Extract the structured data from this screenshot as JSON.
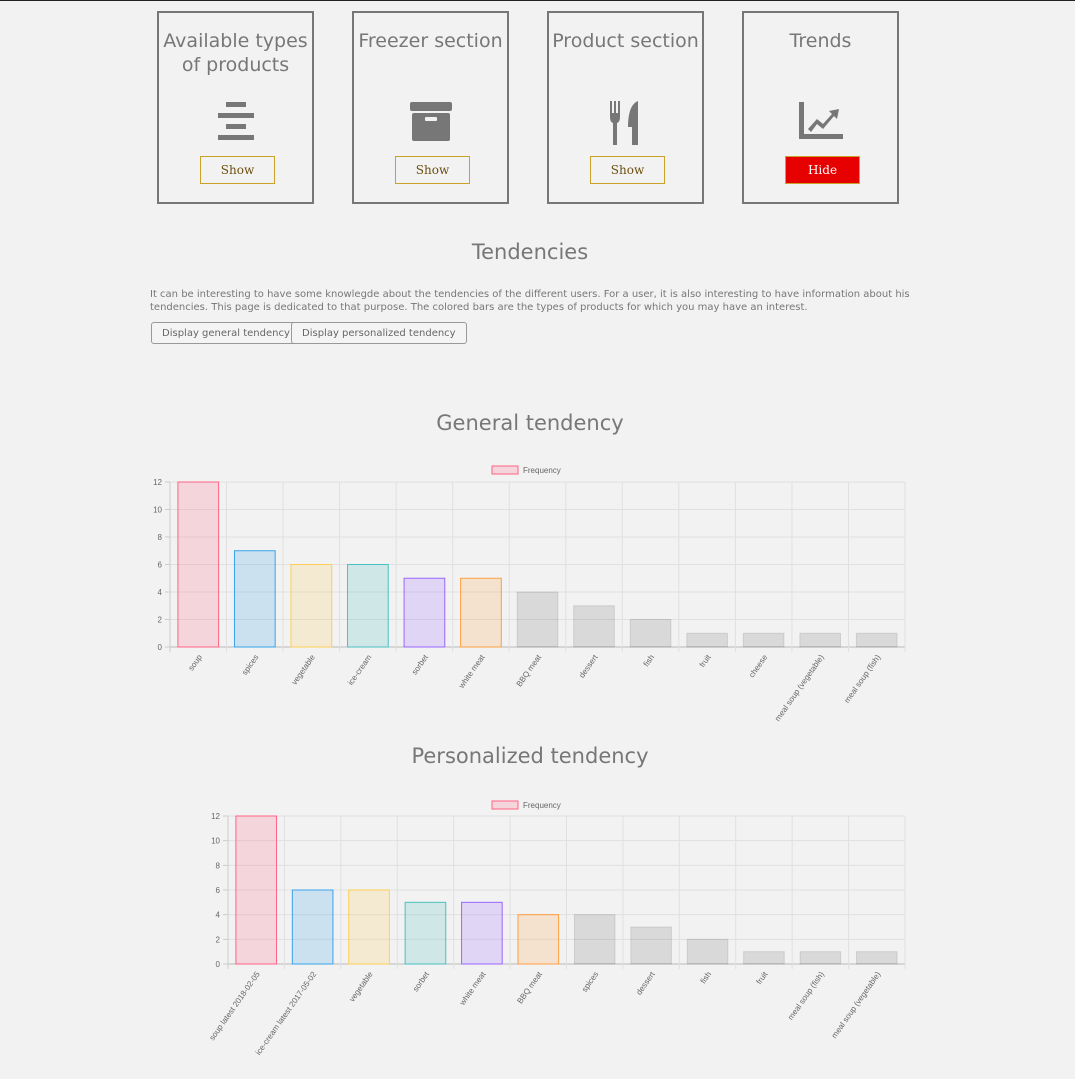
{
  "cards": [
    {
      "title": "Available types of products",
      "icon": "list-align-center-icon",
      "button": "Show"
    },
    {
      "title": "Freezer section",
      "icon": "archive-box-icon",
      "button": "Show"
    },
    {
      "title": "Product section",
      "icon": "fork-knife-icon",
      "button": "Show"
    },
    {
      "title": "Trends",
      "icon": "chart-line-icon",
      "button": "Hide"
    }
  ],
  "tendencies": {
    "title": "Tendencies",
    "intro": "It can be interesting to have some knowlegde about the tendencies of the different users. For a user, it is also interesting to have information about his tendencies. This page is dedicated to that purpose. The colored bars are the types of products for which you may have an interest.",
    "general_button": "Display general tendency",
    "personalized_button": "Display personalized tendency"
  },
  "general_title": "General tendency",
  "personalized_title": "Personalized tendency",
  "colors": {
    "hide_button": "#e60000",
    "button_border": "#c9a227"
  },
  "chart_data": [
    {
      "type": "bar",
      "legend": "Frequency",
      "categories": [
        "soup",
        "spices",
        "vegetable",
        "ice-cream",
        "sorbet",
        "white meat",
        "BBQ meat",
        "dessert",
        "fish",
        "fruit",
        "cheese",
        "meal soup (vegetable)",
        "meal soup (fish)"
      ],
      "values": [
        12,
        7,
        6,
        6,
        5,
        5,
        4,
        3,
        2,
        1,
        1,
        1,
        1
      ],
      "yticks": [
        0,
        2,
        4,
        6,
        8,
        10,
        12
      ],
      "ylim": [
        0,
        12
      ]
    },
    {
      "type": "bar",
      "legend": "Frequency",
      "categories": [
        "soup latest 2018-02-05",
        "ice-cream latest 2017-05-02",
        "vegetable",
        "sorbet",
        "white meat",
        "BBQ meat",
        "spices",
        "dessert",
        "fish",
        "fruit",
        "meal soup (fish)",
        "meal soup (vegetable)"
      ],
      "values": [
        12,
        6,
        6,
        5,
        5,
        4,
        4,
        3,
        2,
        1,
        1,
        1
      ],
      "yticks": [
        0,
        2,
        4,
        6,
        8,
        10,
        12
      ],
      "ylim": [
        0,
        12
      ]
    }
  ]
}
